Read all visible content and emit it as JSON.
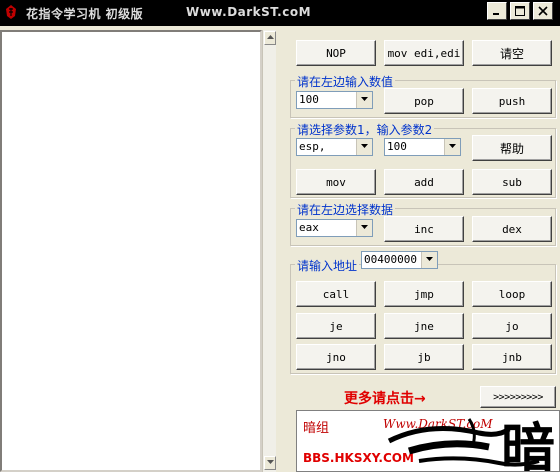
{
  "window": {
    "title": "花指令学习机 初级版",
    "site": "Www.DarkST.coM"
  },
  "row1": {
    "nop": "NOP",
    "movedi": "mov edi,edi",
    "clear": "请空"
  },
  "group1": {
    "legend": "请在左边输入数值",
    "combo_value": "100",
    "pop": "pop",
    "push": "push"
  },
  "group2": {
    "legend": "请选择参数1，输入参数2",
    "param1": "esp,",
    "param2": "100",
    "help": "帮助",
    "mov": "mov",
    "add": "add",
    "sub": "sub"
  },
  "group3": {
    "legend": "请在左边选择数据",
    "register": "eax",
    "inc": "inc",
    "dex": "dex"
  },
  "group4": {
    "legend": "请输入地址",
    "address": "00400000",
    "jumps": [
      "call",
      "jmp",
      "loop",
      "je",
      "jne",
      "jo",
      "jno",
      "jb",
      "jnb"
    ]
  },
  "more": {
    "text": "更多请点击→",
    "button": ">>>>>>>>>"
  },
  "ad": {
    "name": "暗组",
    "site": "Www.DarkST.coM",
    "bbs": "BBS.HKSXY.COM",
    "logo_char": "暗"
  },
  "colors": {
    "legend": "#0033cc",
    "more": "#e00000",
    "titlebar": "#000000"
  }
}
